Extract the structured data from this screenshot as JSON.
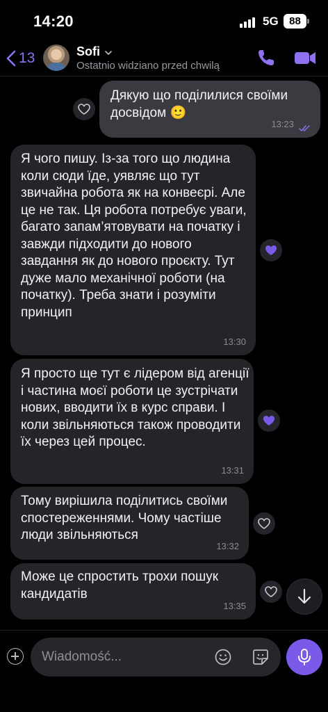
{
  "status_bar": {
    "time": "14:20",
    "network": "5G",
    "battery": "88"
  },
  "header": {
    "back_count": "13",
    "contact_name": "Sofi",
    "last_seen": "Ostatnio widziano przed chwilą",
    "icons": [
      "phone-icon",
      "video-icon"
    ]
  },
  "messages": [
    {
      "direction": "outgoing",
      "text": "Дякую що поділилися своїми досвідом 🙂",
      "time": "13:23",
      "status": "read",
      "reaction": "empty-heart"
    },
    {
      "direction": "incoming",
      "text": "Я чого пишу. Із-за того що людина коли сюди їде, уявляє що тут звичайна робота як на конвеєрі. Але це не так. Ця робота потребує уваги, багато запам’ятовувати на початку і завжди підходити до нового завдання як до нового проєкту. Тут дуже мало механічної роботи (на початку). Треба знати і розуміти принцип",
      "time": "13:30",
      "reaction": "filled-heart"
    },
    {
      "direction": "incoming",
      "text": "Я просто ще тут є лідером від агенції і частина моєї роботи це зустрічати нових, вводити їх в курс справи. І коли звільняються також проводити їх через цей процес.",
      "time": "13:31",
      "reaction": "filled-heart"
    },
    {
      "direction": "incoming",
      "text": "Тому вирішила поділитись своїми спостереженнями. Чому частіше люди звільняються",
      "time": "13:32",
      "reaction": "empty-heart"
    },
    {
      "direction": "incoming",
      "text": "Може це спростить трохи  пошук кандидатів",
      "time": "13:35",
      "reaction": "empty-heart"
    }
  ],
  "composer": {
    "placeholder": "Wiadomość..."
  },
  "colors": {
    "accent": "#8e72f0",
    "incoming_bubble": "#242429",
    "outgoing_bubble": "#3a3a41",
    "reaction_heart": "#7a5ae8",
    "background": "#000000"
  }
}
